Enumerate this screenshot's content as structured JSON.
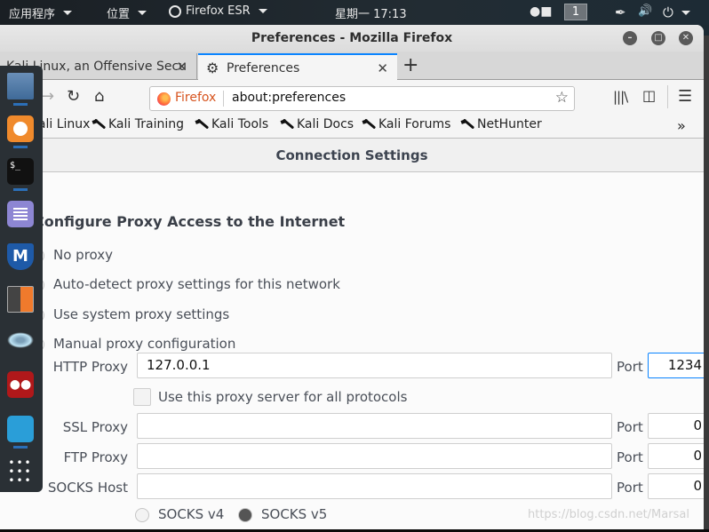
{
  "topbar": {
    "applications": "应用程序",
    "places": "位置",
    "active_app": "Firefox ESR",
    "clock": "星期一 17:13",
    "workspace": "1",
    "icons": [
      "camera-icon",
      "pen-icon",
      "volume-icon",
      "power-icon"
    ]
  },
  "window": {
    "title": "Preferences - Mozilla Firefox",
    "controls": [
      "minimize",
      "maximize",
      "close"
    ]
  },
  "tabs": [
    {
      "label": "Kali Linux, an Offensive Secu",
      "active": false
    },
    {
      "label": "Preferences",
      "active": true,
      "icon": "gear-icon"
    }
  ],
  "navbar": {
    "identity": "Firefox",
    "url": "about:preferences"
  },
  "bookmarks": [
    {
      "label": "Kali Linux"
    },
    {
      "label": "Kali Training"
    },
    {
      "label": "Kali Tools"
    },
    {
      "label": "Kali Docs"
    },
    {
      "label": "Kali Forums"
    },
    {
      "label": "NetHunter"
    }
  ],
  "dialog": {
    "title": "Connection Settings",
    "section_title": "Configure Proxy Access to the Internet",
    "radios": [
      {
        "label": "No proxy",
        "selected": false
      },
      {
        "label": "Auto-detect proxy settings for this network",
        "selected": false
      },
      {
        "label": "Use system proxy settings",
        "selected": false
      },
      {
        "label": "Manual proxy configuration",
        "selected": true
      }
    ],
    "http_proxy": {
      "label": "HTTP Proxy",
      "value": "127.0.0.1",
      "port_label": "Port",
      "port": "1234"
    },
    "use_for_all": {
      "label": "Use this proxy server for all protocols",
      "checked": false
    },
    "ssl_proxy": {
      "label": "SSL Proxy",
      "value": "",
      "port_label": "Port",
      "port": "0"
    },
    "ftp_proxy": {
      "label": "FTP Proxy",
      "value": "",
      "port_label": "Port",
      "port": "0"
    },
    "socks_host": {
      "label": "SOCKS Host",
      "value": "",
      "port_label": "Port",
      "port": "0"
    },
    "socks_versions": [
      "SOCKS v4",
      "SOCKS v5"
    ]
  },
  "dock": [
    "files",
    "firefox",
    "terminal",
    "text-editor",
    "metasploit",
    "burpsuite",
    "maltego",
    "cherrytree",
    "wireshark",
    "show-apps"
  ],
  "watermark": "https://blog.csdn.net/Marsal"
}
